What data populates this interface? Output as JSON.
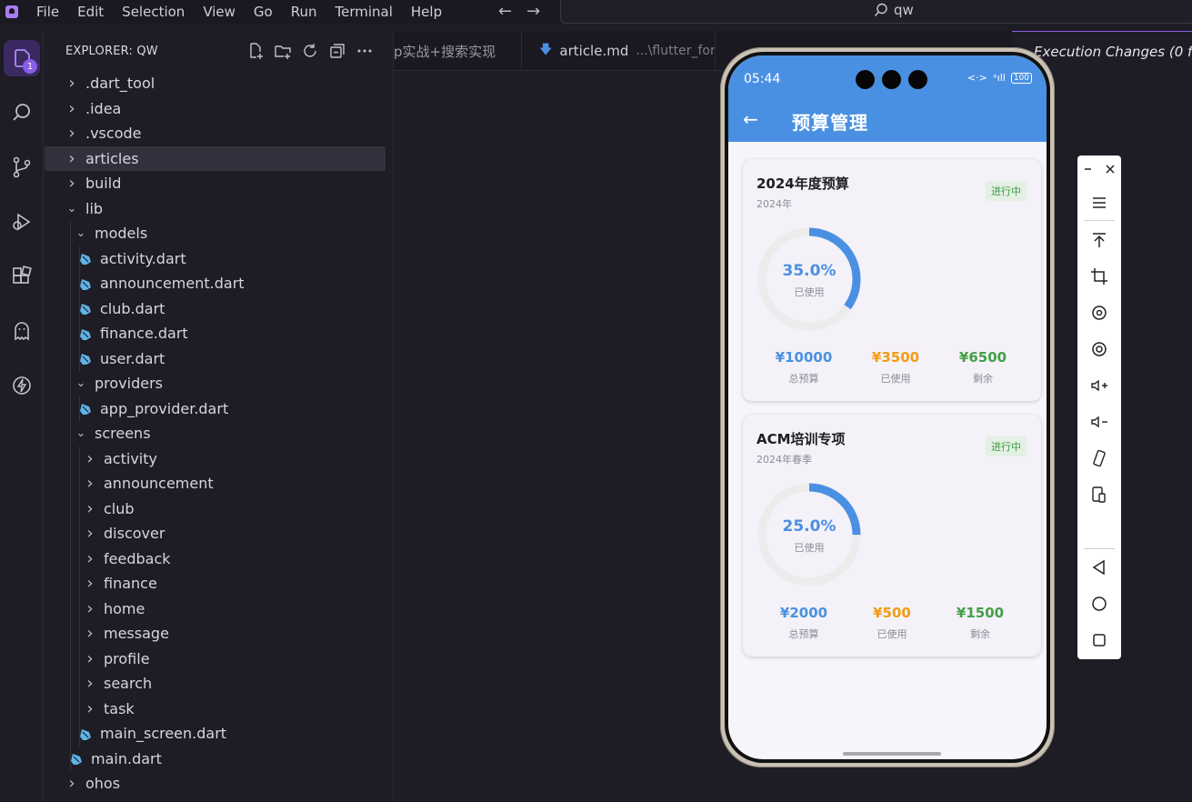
{
  "menubar": {
    "items": [
      "File",
      "Edit",
      "Selection",
      "View",
      "Go",
      "Run",
      "Terminal",
      "Help"
    ],
    "search_text": "qw"
  },
  "explorer": {
    "title": "EXPLORER: QW",
    "tree": [
      {
        "label": ".dart_tool",
        "type": "folder",
        "depth": 0,
        "expanded": false
      },
      {
        "label": ".idea",
        "type": "folder",
        "depth": 0,
        "expanded": false
      },
      {
        "label": ".vscode",
        "type": "folder",
        "depth": 0,
        "expanded": false
      },
      {
        "label": "articles",
        "type": "folder",
        "depth": 0,
        "expanded": false,
        "selected": true
      },
      {
        "label": "build",
        "type": "folder",
        "depth": 0,
        "expanded": false
      },
      {
        "label": "lib",
        "type": "folder",
        "depth": 0,
        "expanded": true
      },
      {
        "label": "models",
        "type": "folder",
        "depth": 1,
        "expanded": true
      },
      {
        "label": "activity.dart",
        "type": "dart",
        "depth": 2
      },
      {
        "label": "announcement.dart",
        "type": "dart",
        "depth": 2
      },
      {
        "label": "club.dart",
        "type": "dart",
        "depth": 2
      },
      {
        "label": "finance.dart",
        "type": "dart",
        "depth": 2
      },
      {
        "label": "user.dart",
        "type": "dart",
        "depth": 2
      },
      {
        "label": "providers",
        "type": "folder",
        "depth": 1,
        "expanded": true
      },
      {
        "label": "app_provider.dart",
        "type": "dart",
        "depth": 2
      },
      {
        "label": "screens",
        "type": "folder",
        "depth": 1,
        "expanded": true
      },
      {
        "label": "activity",
        "type": "folder",
        "depth": 2,
        "expanded": false
      },
      {
        "label": "announcement",
        "type": "folder",
        "depth": 2,
        "expanded": false
      },
      {
        "label": "club",
        "type": "folder",
        "depth": 2,
        "expanded": false
      },
      {
        "label": "discover",
        "type": "folder",
        "depth": 2,
        "expanded": false
      },
      {
        "label": "feedback",
        "type": "folder",
        "depth": 2,
        "expanded": false
      },
      {
        "label": "finance",
        "type": "folder",
        "depth": 2,
        "expanded": false
      },
      {
        "label": "home",
        "type": "folder",
        "depth": 2,
        "expanded": false
      },
      {
        "label": "message",
        "type": "folder",
        "depth": 2,
        "expanded": false
      },
      {
        "label": "profile",
        "type": "folder",
        "depth": 2,
        "expanded": false
      },
      {
        "label": "search",
        "type": "folder",
        "depth": 2,
        "expanded": false
      },
      {
        "label": "task",
        "type": "folder",
        "depth": 2,
        "expanded": false
      },
      {
        "label": "main_screen.dart",
        "type": "dart",
        "depth": 2
      },
      {
        "label": "main.dart",
        "type": "dart",
        "depth": 1
      },
      {
        "label": "ohos",
        "type": "folder",
        "depth": 0,
        "expanded": false
      }
    ]
  },
  "activitybar": {
    "badge_count": "1"
  },
  "editor": {
    "tabs": [
      {
        "label": "p实战+搜索实现",
        "sub": ""
      },
      {
        "label": "article.md",
        "sub": "...\\flutter_for_openl"
      },
      {
        "label": "Execution Changes (0 f",
        "sub": ""
      }
    ]
  },
  "phone": {
    "status": {
      "time": "05:44",
      "battery": "100"
    },
    "page_title": "预算管理",
    "budgets": [
      {
        "name": "2024年度预算",
        "period": "2024年",
        "status": "进行中",
        "used_fraction": 0.35,
        "percent_label": "35.0%",
        "used_label": "已使用",
        "stats": [
          {
            "value": "¥10000",
            "label": "总预算"
          },
          {
            "value": "¥3500",
            "label": "已使用"
          },
          {
            "value": "¥6500",
            "label": "剩余"
          }
        ]
      },
      {
        "name": "ACM培训专项",
        "period": "2024年春季",
        "status": "进行中",
        "used_fraction": 0.25,
        "percent_label": "25.0%",
        "used_label": "已使用",
        "stats": [
          {
            "value": "¥2000",
            "label": "总预算"
          },
          {
            "value": "¥500",
            "label": "已使用"
          },
          {
            "value": "¥1500",
            "label": "剩余"
          }
        ]
      }
    ]
  },
  "colors": {
    "appbar": "#4a90e2",
    "ring_used": "#4a90e2",
    "ring_track": "#ececec",
    "total": "#4a90e2",
    "used": "#f39c12",
    "remaining": "#43a047",
    "chip_text": "#3d9a45",
    "accent": "#8a5ce8"
  }
}
